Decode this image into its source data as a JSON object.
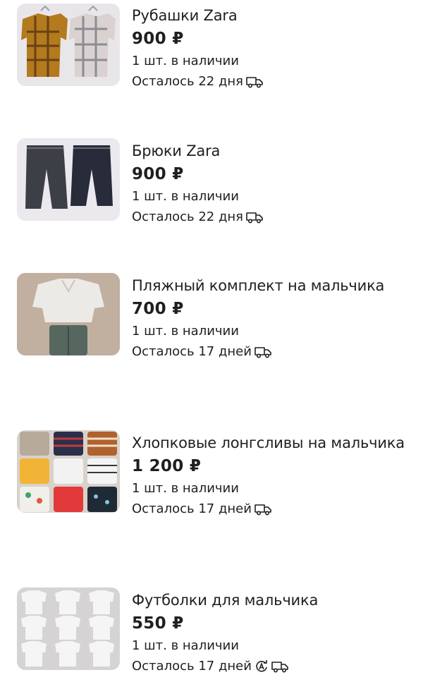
{
  "items": [
    {
      "title": "Рубашки Zara",
      "price": "900 ₽",
      "stock": "1 шт. в наличии",
      "remaining": "Осталось 22 дня",
      "icons": [
        "delivery-truck-icon"
      ]
    },
    {
      "title": "Брюки Zara",
      "price": "900 ₽",
      "stock": "1 шт. в наличии",
      "remaining": "Осталось 22 дня",
      "icons": [
        "delivery-truck-icon"
      ]
    },
    {
      "title": "Пляжный комплект на мальчика",
      "price": "700 ₽",
      "stock": "1 шт. в наличии",
      "remaining": "Осталось 17 дней",
      "icons": [
        "delivery-truck-icon"
      ]
    },
    {
      "title": "Хлопковые лонгсливы на мальчика",
      "price": "1 200 ₽",
      "stock": "1 шт. в наличии",
      "remaining": "Осталось 17 дней",
      "icons": [
        "delivery-truck-icon"
      ]
    },
    {
      "title": "Футболки для мальчика",
      "price": "550 ₽",
      "stock": "1 шт. в наличии",
      "remaining": "Осталось 17 дней",
      "icons": [
        "autoload-badge-icon",
        "delivery-truck-icon"
      ]
    }
  ]
}
